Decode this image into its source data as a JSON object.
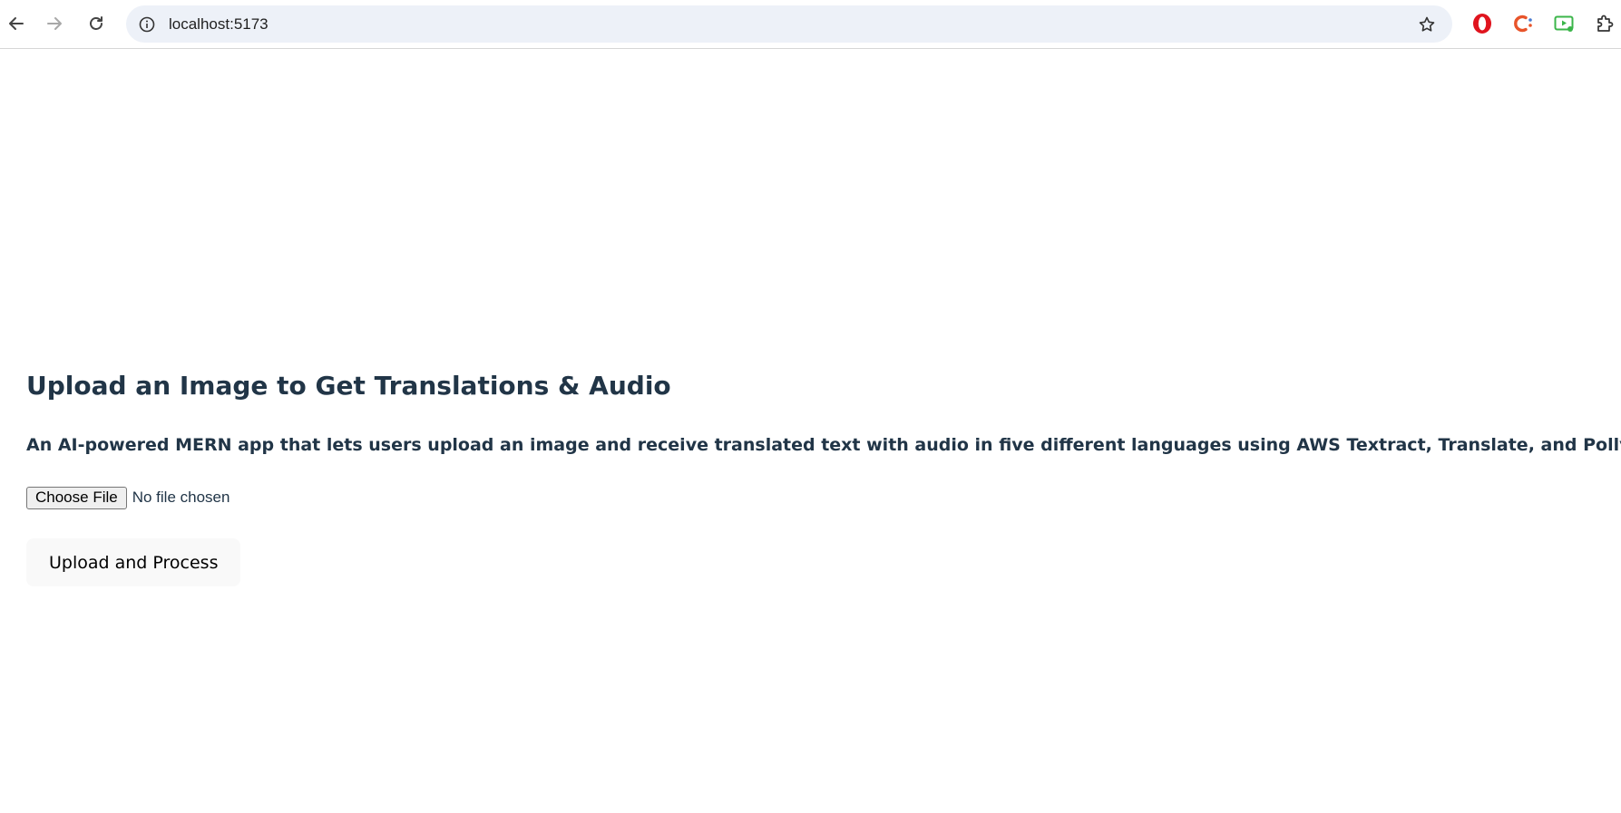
{
  "browser": {
    "url": "localhost:5173",
    "icons": {
      "back": "back-arrow-icon",
      "forward": "forward-arrow-icon",
      "reload": "reload-icon",
      "site_info": "info-icon",
      "bookmark": "star-icon",
      "extensions": [
        "opera-extension-icon",
        "c-extension-icon",
        "screen-record-extension-icon",
        "puzzle-extensions-icon"
      ]
    }
  },
  "page": {
    "title": "Upload an Image to Get Translations & Audio",
    "subtitle": "An AI-powered MERN app that lets users upload an image and receive translated text with audio in five different languages using AWS Textract, Translate, and Polly",
    "file_input": {
      "button_label": "Choose File",
      "status": "No file chosen"
    },
    "upload_button_label": "Upload and Process"
  },
  "colors": {
    "text": "#213547",
    "omnibox_bg": "#edf1f8",
    "button_bg": "#f9f9f9"
  }
}
